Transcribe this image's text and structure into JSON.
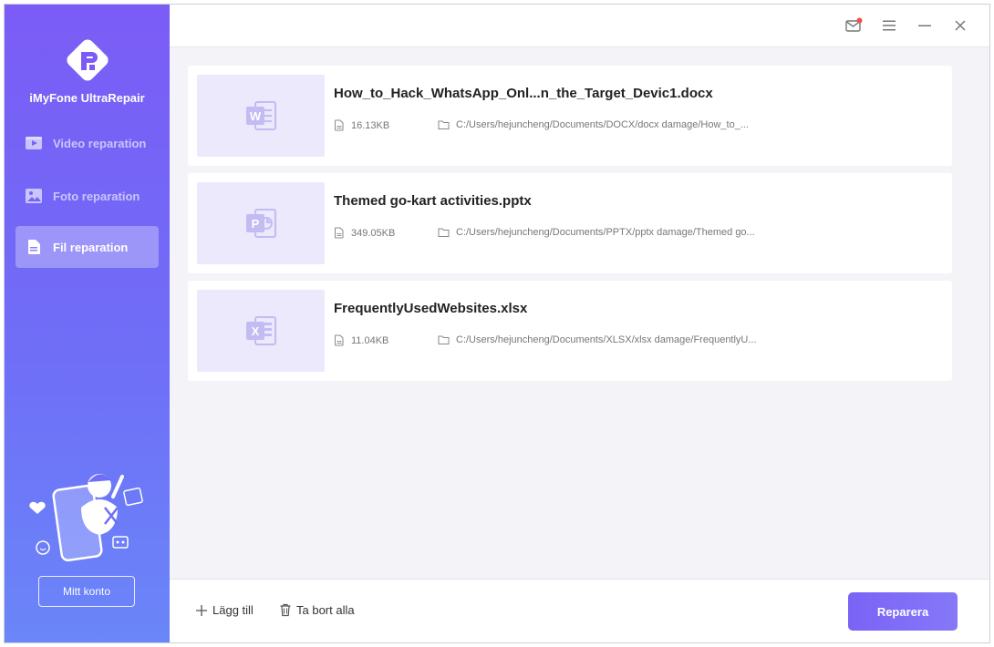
{
  "app": {
    "name": "iMyFone UltraRepair",
    "accent_color": "#7b5cf6"
  },
  "sidebar": {
    "items": [
      {
        "label": "Video reparation",
        "icon": "video-icon",
        "active": false
      },
      {
        "label": "Foto reparation",
        "icon": "photo-icon",
        "active": false
      },
      {
        "label": "Fil reparation",
        "icon": "file-icon",
        "active": true
      }
    ],
    "account_label": "Mitt konto"
  },
  "titlebar": {
    "icons": [
      "mail-icon",
      "menu-icon",
      "minimize-icon",
      "close-icon"
    ],
    "notification_color": "#f0504a"
  },
  "files": [
    {
      "name": "How_to_Hack_WhatsApp_Onl...n_the_Target_Devic1.docx",
      "size": "16.13KB",
      "path": "C:/Users/hejuncheng/Documents/DOCX/docx damage/How_to_...",
      "type_icon": "word-icon",
      "type_letter": "W"
    },
    {
      "name": "Themed go-kart activities.pptx",
      "size": "349.05KB",
      "path": "C:/Users/hejuncheng/Documents/PPTX/pptx damage/Themed go...",
      "type_icon": "powerpoint-icon",
      "type_letter": "P"
    },
    {
      "name": "FrequentlyUsedWebsites.xlsx",
      "size": "11.04KB",
      "path": "C:/Users/hejuncheng/Documents/XLSX/xlsx damage/FrequentlyU...",
      "type_icon": "excel-icon",
      "type_letter": "X"
    }
  ],
  "footer": {
    "add_label": "Lägg till",
    "delete_all_label": "Ta bort alla",
    "repair_label": "Reparera"
  }
}
